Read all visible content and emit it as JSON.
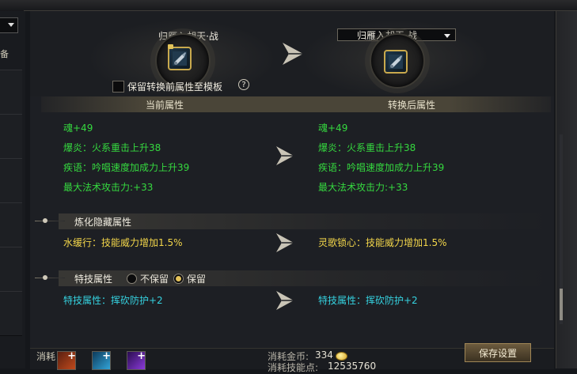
{
  "left_panel": {
    "label_top": "备",
    "label_bottom": "消耗"
  },
  "item": {
    "current_name": "归雁入胡天·战",
    "target_name": "归雁入胡天·战"
  },
  "options": {
    "keep_label": "保留转换前属性至模板",
    "help_glyph": "?"
  },
  "columns": {
    "current": "当前属性",
    "after": "转换后属性"
  },
  "base_attrs": {
    "current": [
      "魂+49",
      "爆炎：火系重击上升38",
      "疾语：吟唱速度加成力上升39",
      "最大法术攻击力:+33"
    ],
    "after": [
      "魂+49",
      "爆炎：火系重击上升38",
      "疾语：吟唱速度加成力上升39",
      "最大法术攻击力:+33"
    ]
  },
  "refine_section": {
    "title": "炼化隐藏属性",
    "current": "水缓行：技能威力增加1.5%",
    "after": "灵歌锁心：技能威力增加1.5%"
  },
  "special_section": {
    "title": "特技属性",
    "option_discard": "不保留",
    "option_keep": "保留",
    "selected": "保留",
    "current": "特技属性：挥砍防护+2",
    "after": "特技属性：挥砍防护+2"
  },
  "cost": {
    "gold_label": "消耗金币:",
    "gold_value": "334",
    "points_label": "消耗技能点:",
    "points_value": "12535760"
  },
  "save_button": "保存设置",
  "colors": {
    "base_attr": "#35d93f",
    "refine_attr": "#f3d64a",
    "special_attr": "#35d2e0",
    "item_frame": "#c9a94d"
  }
}
